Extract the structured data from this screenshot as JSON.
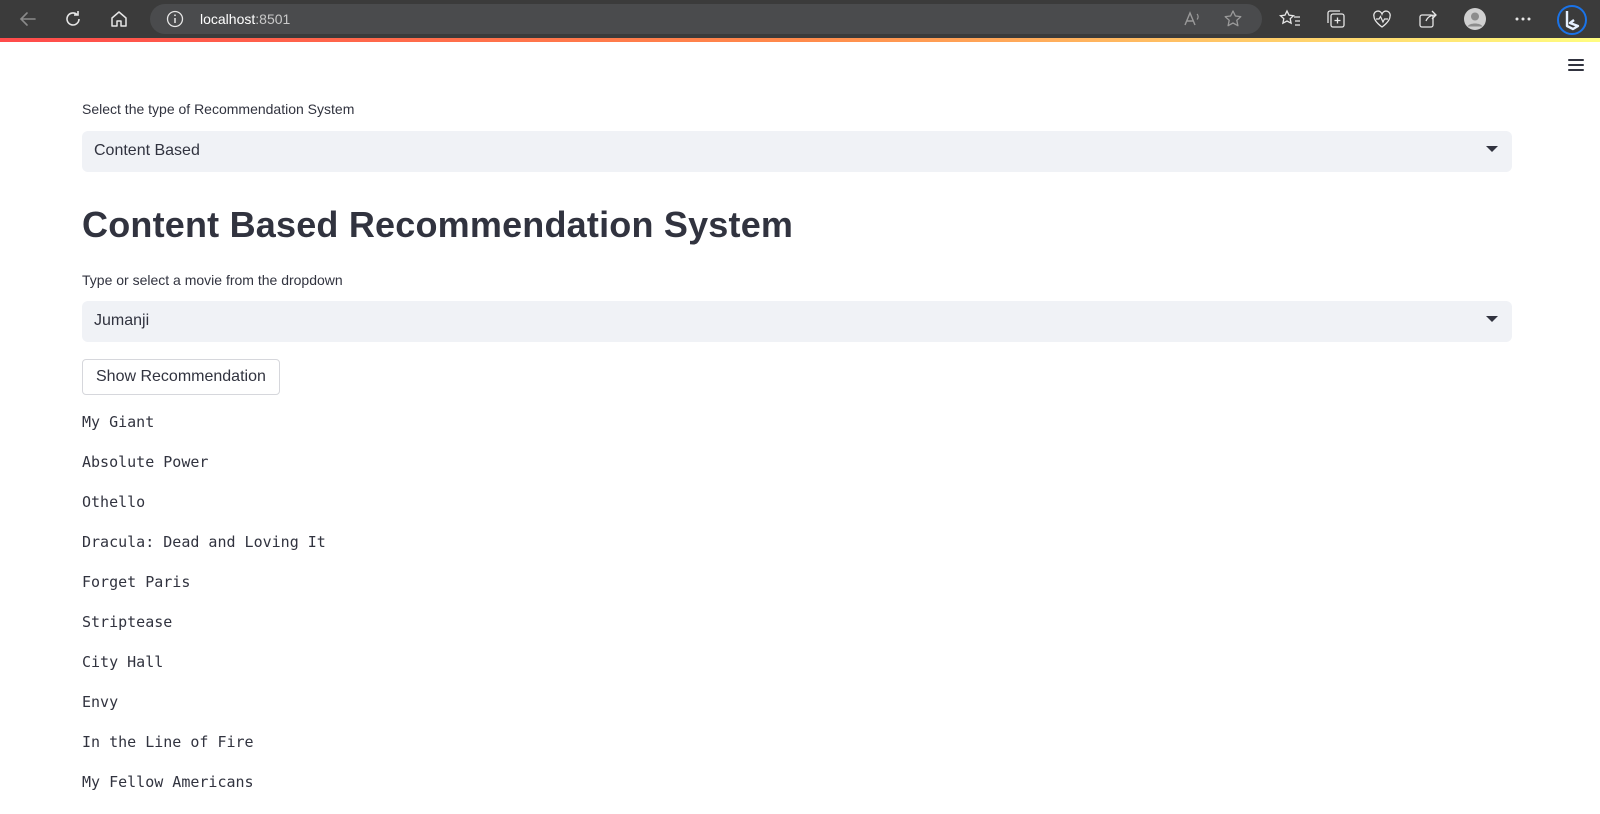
{
  "browser": {
    "url_host": "localhost",
    "url_port": ":8501"
  },
  "app": {
    "type_label": "Select the type of Recommendation System",
    "type_selected": "Content Based",
    "title": "Content Based Recommendation System",
    "movie_label": "Type or select a movie from the dropdown",
    "movie_selected": "Jumanji",
    "button_label": "Show Recommendation",
    "recommendations": [
      "My Giant",
      "Absolute Power",
      "Othello",
      "Dracula: Dead and Loving It",
      "Forget Paris",
      "Striptease",
      "City Hall",
      "Envy",
      "In the Line of Fire",
      "My Fellow Americans"
    ]
  },
  "colors": {
    "browser_bg": "#3b3b3b",
    "select_bg": "#f0f2f6",
    "text": "#31333f",
    "accent_red": "#ff4b4b",
    "bing_blue": "#1a73e8"
  }
}
